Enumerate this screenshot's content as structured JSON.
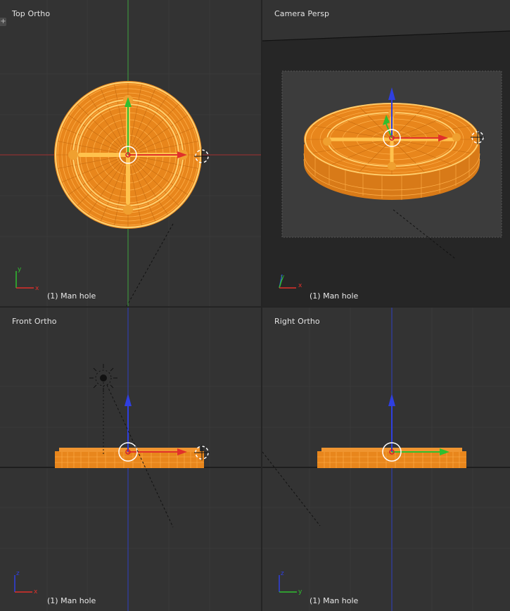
{
  "viewports": [
    {
      "title": "Top Ortho",
      "object_label": "(1) Man hole",
      "axis_labels": [
        "y",
        "x"
      ]
    },
    {
      "title": "Camera Persp",
      "object_label": "(1) Man hole",
      "axis_labels": [
        "y",
        "x"
      ]
    },
    {
      "title": "Front Ortho",
      "object_label": "(1) Man hole",
      "axis_labels": [
        "z",
        "x"
      ]
    },
    {
      "title": "Right Ortho",
      "object_label": "(1) Man hole",
      "axis_labels": [
        "z",
        "y"
      ]
    }
  ],
  "colors": {
    "background": "#333333",
    "camera_background": "#262626",
    "camera_frame": "#3c3c3c",
    "mesh_wire": "#ff9a22",
    "mesh_fill": "#e8861c",
    "axis_x": "#e0302a",
    "axis_y": "#2fbf2f",
    "axis_z": "#2f3fe0"
  },
  "icons": [
    "view-expand-icon",
    "3d-cursor-icon",
    "lamp-icon",
    "axis-gizmo-icon",
    "transform-manipulator-icon"
  ]
}
